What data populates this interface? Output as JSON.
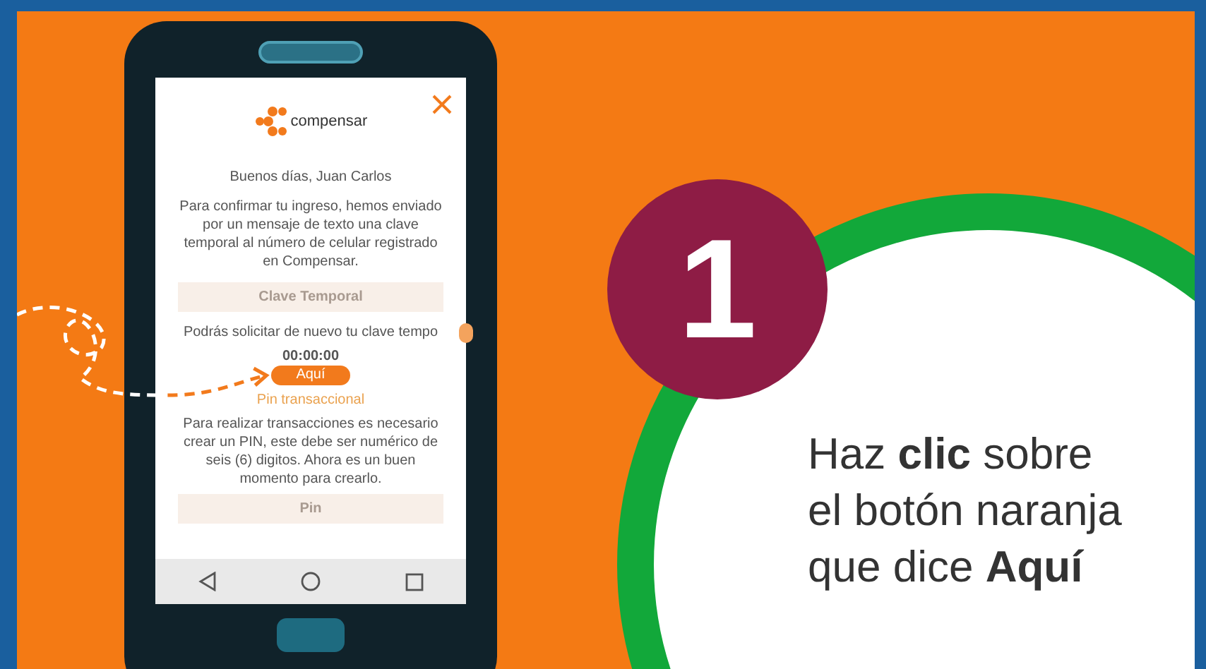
{
  "phone": {
    "logo_text": "compensar",
    "greeting": "Buenos días, Juan Carlos",
    "message": "Para confirmar tu ingreso, hemos enviado por un mensaje de texto una clave temporal al número de celular registrado en Compensar.",
    "temp_key_field": {
      "placeholder": "Clave Temporal"
    },
    "resend_text": "Podrás solicitar de nuevo tu clave tempo",
    "timer": "00:00:00",
    "button": "Aquí",
    "pin_title": "Pin transaccional",
    "pin_message": "Para realizar transacciones es necesario crear un PIN, este debe ser numérico de seis (6) digitos. Ahora es un buen momento para crearlo.",
    "pin_field": {
      "placeholder": "Pin"
    }
  },
  "step": {
    "number": "1",
    "caption": "Haz **clic** sobre\nel botón naranja\nque dice **Aquí**"
  }
}
